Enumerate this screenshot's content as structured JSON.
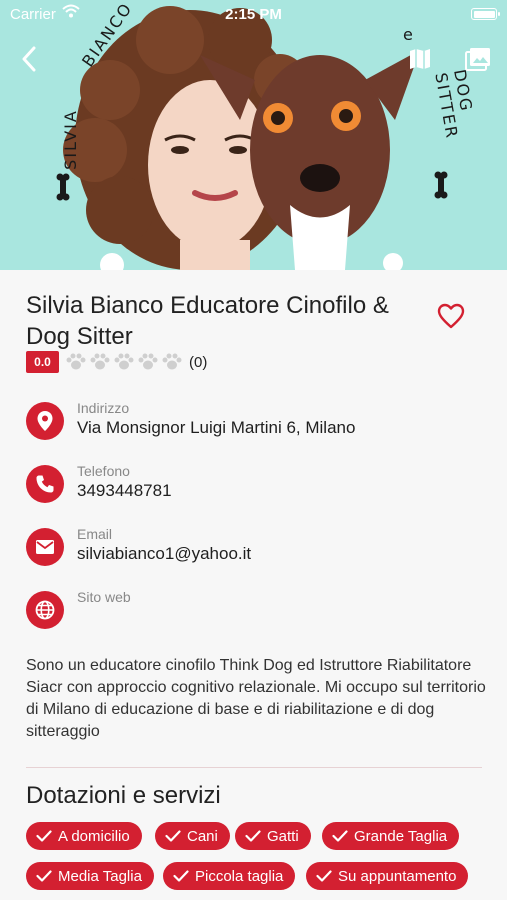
{
  "status_bar": {
    "carrier": "Carrier",
    "time": "2:15 PM"
  },
  "hero": {
    "text_silvia": "SILVIA",
    "text_bianco": "BIANCO",
    "text_e": "e",
    "text_dog_sitter": "DOG SITTER",
    "background_color": "#a9e6df"
  },
  "profile": {
    "title": "Silvia Bianco Educatore Cinofilo & Dog Sitter",
    "rating_value": "0.0",
    "rating_paws": 0,
    "rating_count": "(0)"
  },
  "info": {
    "address_label": "Indirizzo",
    "address_value": "Via Monsignor Luigi Martini 6, Milano",
    "phone_label": "Telefono",
    "phone_value": "3493448781",
    "email_label": "Email",
    "email_value": "silviabianco1@yahoo.it",
    "website_label": "Sito web",
    "website_value": ""
  },
  "description": "Sono un educatore cinofilo Think Dog ed Istruttore Riabilitatore Siacr con approccio cognitivo relazionale. Mi occupo sul territorio di Milano di educazione di base e di riabilitazione e di dog sitteraggio",
  "services": {
    "title": "Dotazioni e servizi",
    "items": [
      "A domicilio",
      "Cani",
      "Gatti",
      "Grande Taglia",
      "Media Taglia",
      "Piccola taglia",
      "Su appuntamento"
    ]
  },
  "colors": {
    "accent": "#d32031",
    "text": "#1f1f1f",
    "muted": "#888888"
  }
}
